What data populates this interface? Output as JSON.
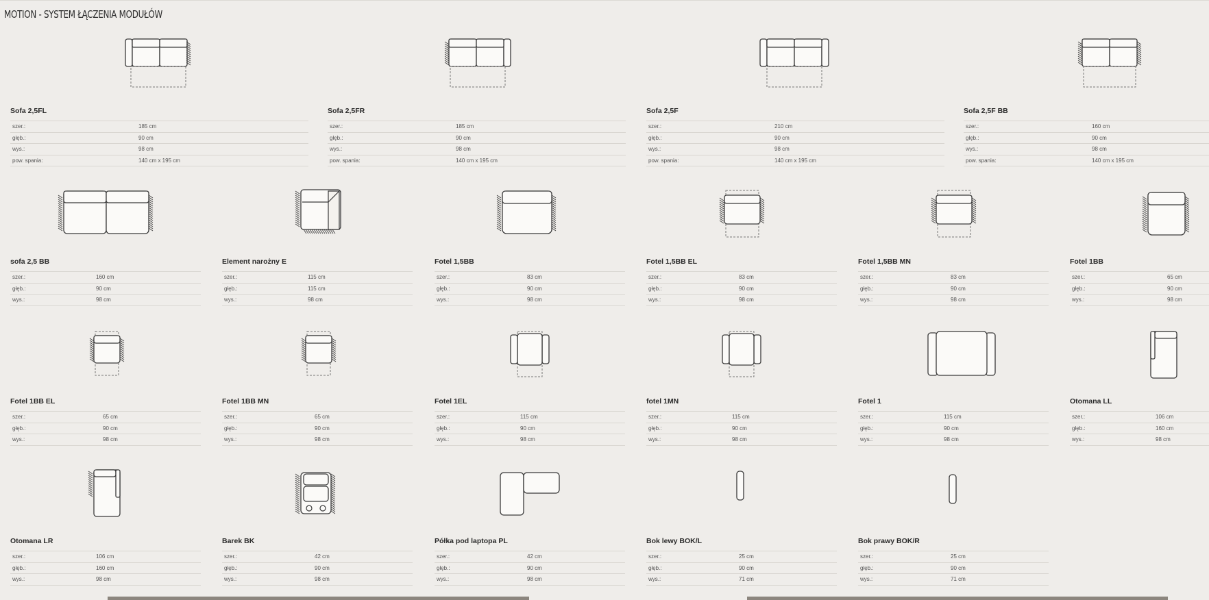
{
  "page": {
    "title": "MOTION - SYSTEM ŁĄCZENIA MODUŁÓW"
  },
  "labels": {
    "width": "szer.:",
    "depth": "głęb.:",
    "height": "wys.:",
    "sleep": "pow. spania:"
  },
  "modules": [
    {
      "name": "Sofa 2,5FL",
      "icon": "sofa-icon",
      "specs": [
        "185 cm",
        "90 cm",
        "98 cm",
        "140 cm x 195 cm"
      ]
    },
    {
      "name": "Sofa 2,5FR",
      "icon": "sofa-icon",
      "specs": [
        "185 cm",
        "90 cm",
        "98 cm",
        "140 cm x 195 cm"
      ]
    },
    {
      "name": "Sofa 2,5F",
      "icon": "sofa-icon",
      "specs": [
        "210 cm",
        "90 cm",
        "98 cm",
        "140 cm x 195 cm"
      ]
    },
    {
      "name": "Sofa 2,5F BB",
      "icon": "sofa-icon",
      "specs": [
        "160 cm",
        "90 cm",
        "98 cm",
        "140 cm x 195 cm"
      ]
    },
    {
      "name": "sofa 2,5 BB",
      "icon": "sofa-icon",
      "specs": [
        "160 cm",
        "90 cm",
        "98 cm"
      ]
    },
    {
      "name": "Element narożny E",
      "icon": "corner-element-icon",
      "specs": [
        "115 cm",
        "115 cm",
        "98 cm"
      ]
    },
    {
      "name": "Fotel 1,5BB",
      "icon": "armchair-icon",
      "specs": [
        "83 cm",
        "90 cm",
        "98 cm"
      ]
    },
    {
      "name": "Fotel 1,5BB EL",
      "icon": "armchair-icon",
      "specs": [
        "83 cm",
        "90 cm",
        "98 cm"
      ]
    },
    {
      "name": "Fotel 1,5BB MN",
      "icon": "armchair-icon",
      "specs": [
        "83 cm",
        "90 cm",
        "98 cm"
      ]
    },
    {
      "name": "Fotel 1BB",
      "icon": "armchair-icon",
      "specs": [
        "65 cm",
        "90 cm",
        "98 cm"
      ]
    },
    {
      "name": "Fotel 1BB EL",
      "icon": "armchair-icon",
      "specs": [
        "65 cm",
        "90 cm",
        "98 cm"
      ]
    },
    {
      "name": "Fotel 1BB MN",
      "icon": "armchair-icon",
      "specs": [
        "65 cm",
        "90 cm",
        "98 cm"
      ]
    },
    {
      "name": "Fotel 1EL",
      "icon": "armchair-icon",
      "specs": [
        "115 cm",
        "90 cm",
        "98 cm"
      ]
    },
    {
      "name": "fotel 1MN",
      "icon": "armchair-icon",
      "specs": [
        "115 cm",
        "90 cm",
        "98 cm"
      ]
    },
    {
      "name": "Fotel 1",
      "icon": "armchair-icon",
      "specs": [
        "115 cm",
        "90 cm",
        "98 cm"
      ]
    },
    {
      "name": "Otomana LL",
      "icon": "ottoman-icon",
      "specs": [
        "106 cm",
        "160 cm",
        "98 cm"
      ]
    },
    {
      "name": "Otomana LR",
      "icon": "ottoman-icon",
      "specs": [
        "106 cm",
        "160 cm",
        "98 cm"
      ]
    },
    {
      "name": "Barek BK",
      "icon": "bar-icon",
      "specs": [
        "42 cm",
        "90 cm",
        "98 cm"
      ]
    },
    {
      "name": "Półka pod laptopa PL",
      "icon": "laptop-shelf-icon",
      "specs": [
        "42 cm",
        "90 cm",
        "98 cm"
      ]
    },
    {
      "name": "Bok lewy BOK/L",
      "icon": "side-panel-icon",
      "specs": [
        "25 cm",
        "90 cm",
        "71 cm"
      ]
    },
    {
      "name": "Bok prawy BOK/R",
      "icon": "side-panel-icon",
      "specs": [
        "25 cm",
        "90 cm",
        "71 cm"
      ]
    }
  ]
}
